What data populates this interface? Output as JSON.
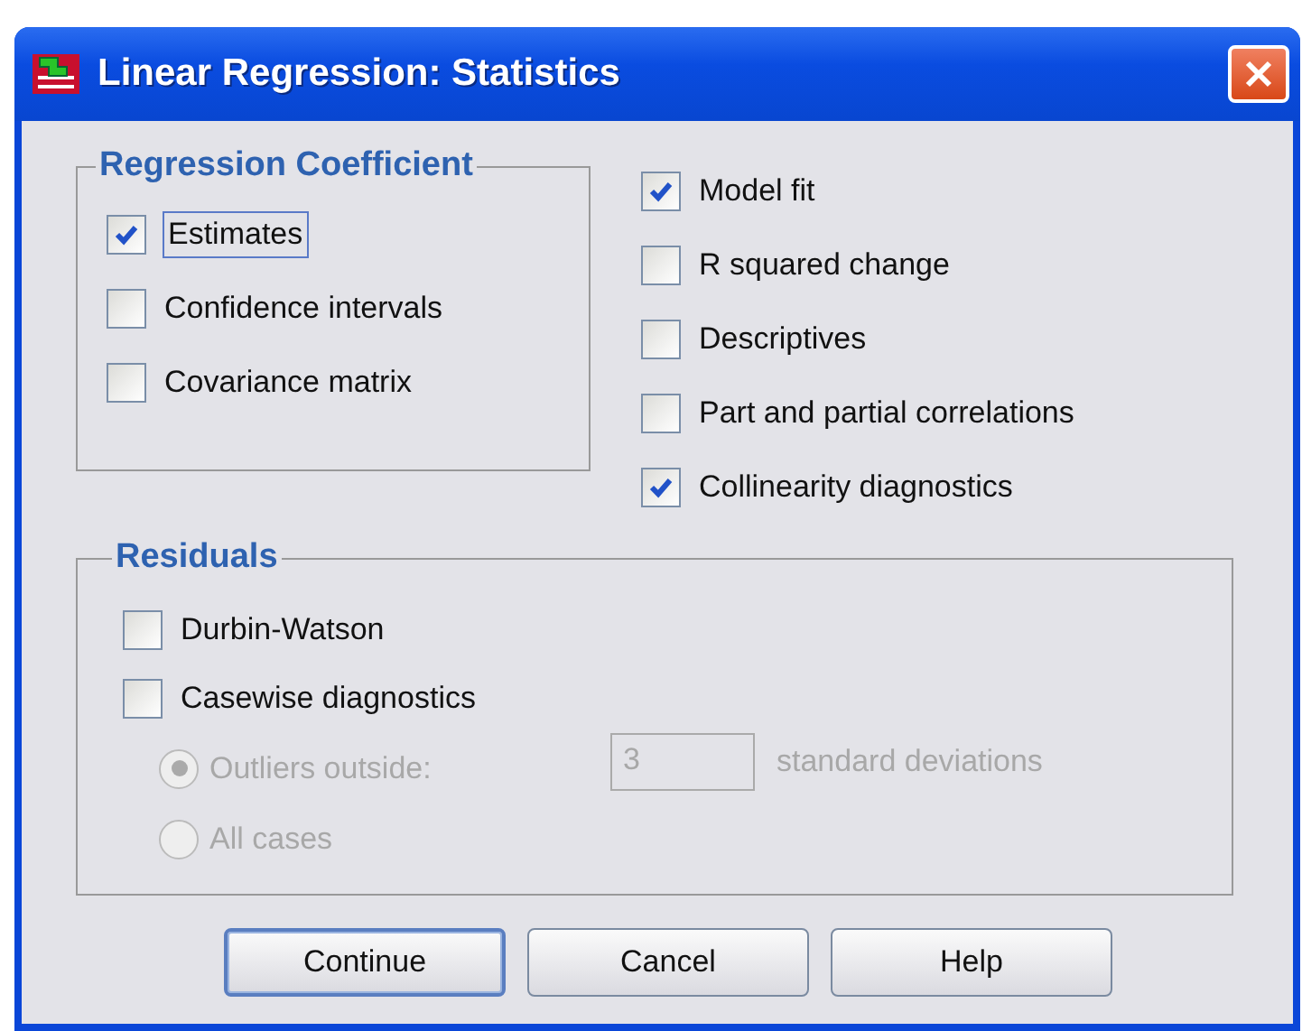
{
  "window": {
    "title": "Linear Regression: Statistics"
  },
  "regression_coefficient": {
    "legend": "Regression Coefficient",
    "options": [
      {
        "label": "Estimates",
        "checked": true,
        "focused": true
      },
      {
        "label": "Confidence intervals",
        "checked": false,
        "focused": false
      },
      {
        "label": "Covariance matrix",
        "checked": false,
        "focused": false
      }
    ]
  },
  "options": [
    {
      "label": "Model fit",
      "checked": true
    },
    {
      "label": "R squared change",
      "checked": false
    },
    {
      "label": "Descriptives",
      "checked": false
    },
    {
      "label": "Part and partial correlations",
      "checked": false
    },
    {
      "label": "Collinearity diagnostics",
      "checked": true
    }
  ],
  "residuals": {
    "legend": "Residuals",
    "options": [
      {
        "label": "Durbin-Watson",
        "checked": false
      },
      {
        "label": "Casewise diagnostics",
        "checked": false
      }
    ],
    "radios": [
      {
        "label": "Outliers outside:",
        "selected": true,
        "disabled": true
      },
      {
        "label": "All cases",
        "selected": false,
        "disabled": true
      }
    ],
    "outlier_value": "3",
    "outlier_disabled": true,
    "unit": "standard deviations"
  },
  "buttons": [
    {
      "label": "Continue",
      "default": true
    },
    {
      "label": "Cancel",
      "default": false
    },
    {
      "label": "Help",
      "default": false
    }
  ]
}
